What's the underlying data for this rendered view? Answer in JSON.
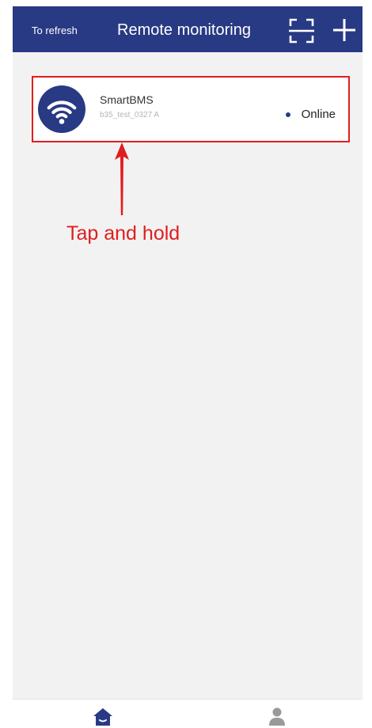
{
  "header": {
    "refresh_label": "To refresh",
    "title": "Remote monitoring",
    "scan_icon": "scan-icon",
    "add_icon": "plus-icon"
  },
  "device": {
    "name": "SmartBMS",
    "id": "b35_test_0327 A",
    "status": "Online",
    "icon": "wifi-icon"
  },
  "annotation": {
    "text": "Tap and hold"
  },
  "bottom_nav": {
    "items": [
      {
        "icon": "home-icon"
      },
      {
        "icon": "user-icon"
      }
    ]
  },
  "colors": {
    "brand": "#283a84",
    "annotation": "#e01e1e",
    "background": "#f3f2f2"
  }
}
